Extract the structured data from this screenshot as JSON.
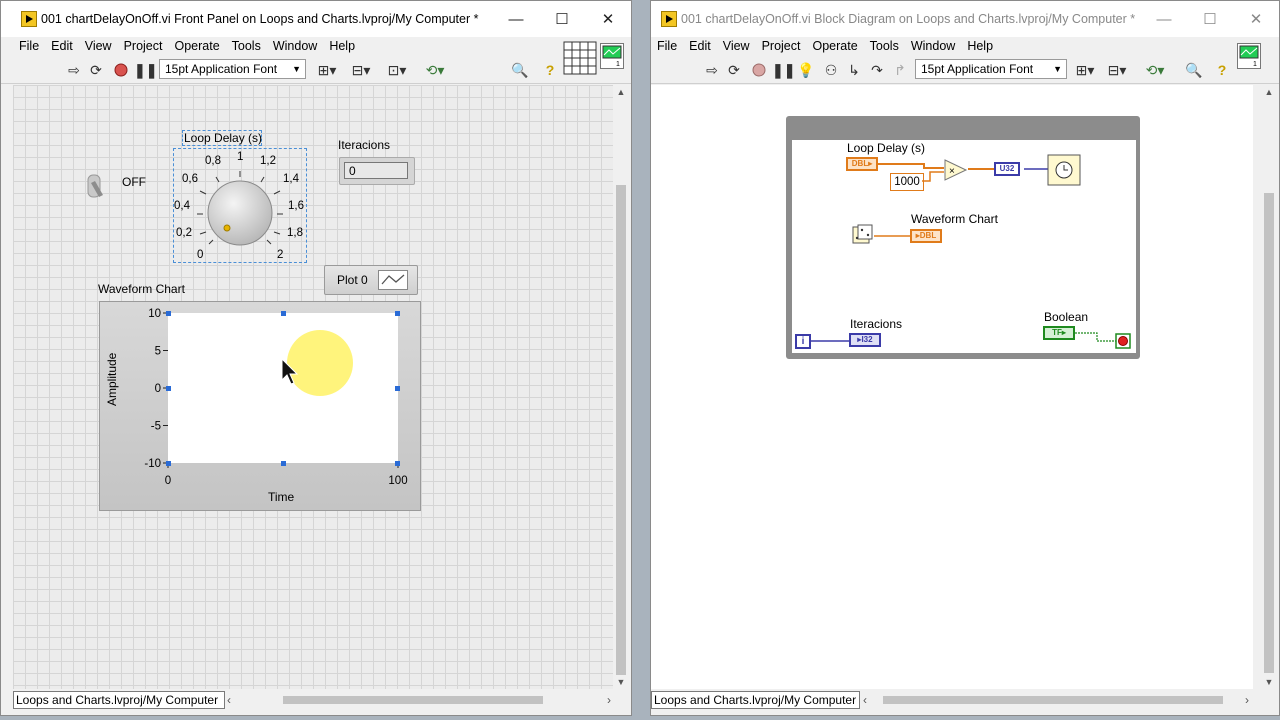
{
  "front_panel": {
    "title": "001 chartDelayOnOff.vi Front Panel on Loops and Charts.lvproj/My Computer *",
    "window_buttons": {
      "minimize": "—",
      "maximize": "☐",
      "close": "✕"
    },
    "menu": [
      "File",
      "Edit",
      "View",
      "Project",
      "Operate",
      "Tools",
      "Window",
      "Help"
    ],
    "font": "15pt Application Font",
    "toggle": {
      "state_label": "OFF"
    },
    "knob": {
      "label": "Loop Delay (s)",
      "ticks": [
        "0",
        "0,2",
        "0,4",
        "0,6",
        "0,8",
        "1",
        "1,2",
        "1,4",
        "1,6",
        "1,8",
        "2"
      ],
      "value": 0
    },
    "iterations": {
      "label": "Iteracions",
      "value": "0"
    },
    "legend": {
      "plot_label": "Plot 0"
    },
    "chart_label": "Waveform Chart",
    "status_path": "Loops and Charts.lvproj/My Computer"
  },
  "chart_data": {
    "type": "line",
    "title": "Waveform Chart",
    "xlabel": "Time",
    "ylabel": "Amplitude",
    "xlim": [
      0,
      100
    ],
    "ylim": [
      -10,
      10
    ],
    "x_ticks": [
      "0",
      "100"
    ],
    "y_ticks": [
      "10",
      "5",
      "0",
      "-5",
      "-10"
    ],
    "series": [
      {
        "name": "Plot 0",
        "values": []
      }
    ],
    "grid": false
  },
  "block_diagram": {
    "title": "001 chartDelayOnOff.vi Block Diagram on Loops and Charts.lvproj/My Computer *",
    "window_buttons": {
      "minimize": "—",
      "maximize": "☐",
      "close": "✕"
    },
    "menu": [
      "File",
      "Edit",
      "View",
      "Project",
      "Operate",
      "Tools",
      "Window",
      "Help"
    ],
    "font": "15pt Application Font",
    "loop_delay_label": "Loop Delay (s)",
    "dbl_tag": "DBL",
    "constant": "1000",
    "u32_tag": "U32",
    "chart_label": "Waveform Chart",
    "iterations_label": "Iteracions",
    "i32_tag": "I32",
    "iteration_terminal": "i",
    "boolean_label": "Boolean",
    "tf_tag": "TF",
    "status_path": "Loops and Charts.lvproj/My Computer"
  }
}
